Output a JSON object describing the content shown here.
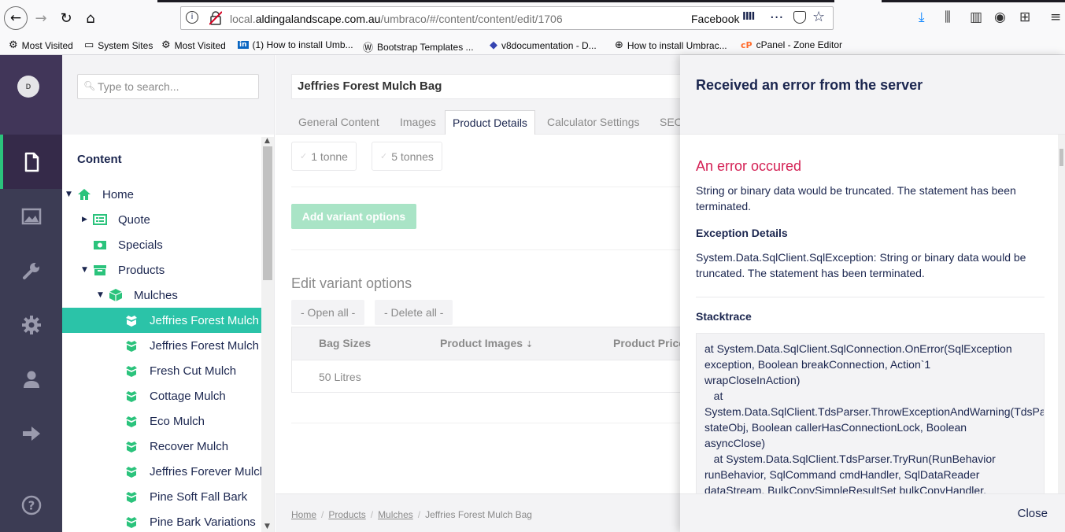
{
  "browser": {
    "url_prefix": "local.",
    "url_domain": "aldingalandscape.com.au",
    "url_path": "/umbraco/#/content/content/edit/1706",
    "facebook_label": "Facebook",
    "bookmarks": [
      {
        "label": "Most Visited",
        "icon": "gear-icon"
      },
      {
        "label": "System Sites",
        "icon": "folder-icon"
      },
      {
        "label": "Most Visited",
        "icon": "gear-icon"
      },
      {
        "label": "(1) How to install Umb...",
        "icon": "linkedin-icon"
      },
      {
        "label": "Bootstrap Templates ...",
        "icon": "w-icon"
      },
      {
        "label": "v8documentation - D...",
        "icon": "umbraco-icon"
      },
      {
        "label": "How to install Umbrac...",
        "icon": "globe-icon"
      },
      {
        "label": "cPanel - Zone Editor",
        "icon": "cpanel-icon"
      }
    ]
  },
  "user": {
    "initial": "D"
  },
  "tree": {
    "search_placeholder": "Type to search...",
    "title": "Content",
    "nodes": [
      {
        "label": "Home"
      },
      {
        "label": "Quote"
      },
      {
        "label": "Specials"
      },
      {
        "label": "Products"
      },
      {
        "label": "Mulches"
      },
      {
        "label": "Jeffries Forest Mulch"
      },
      {
        "label": "Jeffries Forest Mulch"
      },
      {
        "label": "Fresh Cut Mulch"
      },
      {
        "label": "Cottage Mulch"
      },
      {
        "label": "Eco Mulch"
      },
      {
        "label": "Recover Mulch"
      },
      {
        "label": "Jeffries Forever Mulch"
      },
      {
        "label": "Pine Soft Fall Bark"
      },
      {
        "label": "Pine Bark Variations"
      }
    ]
  },
  "editor": {
    "name": "Jeffries Forest Mulch Bag",
    "tabs": [
      "General Content",
      "Images",
      "Product Details",
      "Calculator Settings",
      "SEO"
    ],
    "chips": [
      "1 tonne",
      "5 tonnes"
    ],
    "add_variant": "Add variant options",
    "edit_variant_title": "Edit variant options",
    "open_all": "- Open all -",
    "delete_all": "- Delete all -",
    "table_headers": [
      "Bag Sizes",
      "Product Images",
      "Product Price"
    ],
    "table_row": [
      "50 Litres"
    ],
    "breadcrumb": [
      "Home",
      "Products",
      "Mulches",
      "Jeffries Forest Mulch Bag"
    ]
  },
  "error": {
    "header": "Received an error from the server",
    "title": "An error occured",
    "message": "String or binary data would be truncated. The statement has been terminated.",
    "exception_title": "Exception Details",
    "exception_message": "System.Data.SqlClient.SqlException: String or binary data would be truncated. The statement has been terminated.",
    "stacktrace_title": "Stacktrace",
    "stacktrace": "at System.Data.SqlClient.SqlConnection.OnError(SqlException\nexception, Boolean breakConnection, Action`1\nwrapCloseInAction)\n   at\nSystem.Data.SqlClient.TdsParser.ThrowExceptionAndWarning(TdsParserStateObject\nstateObj, Boolean callerHasConnectionLock, Boolean\nasyncClose)\n   at System.Data.SqlClient.TdsParser.TryRun(RunBehavior\nrunBehavior, SqlCommand cmdHandler, SqlDataReader\ndataStream, BulkCopySimpleResultSet bulkCopyHandler,",
    "close": "Close"
  },
  "colors": {
    "accent": "#2bc37c",
    "selected": "#2bc3a8",
    "error": "#d42054",
    "nav": "#3c3c54"
  }
}
